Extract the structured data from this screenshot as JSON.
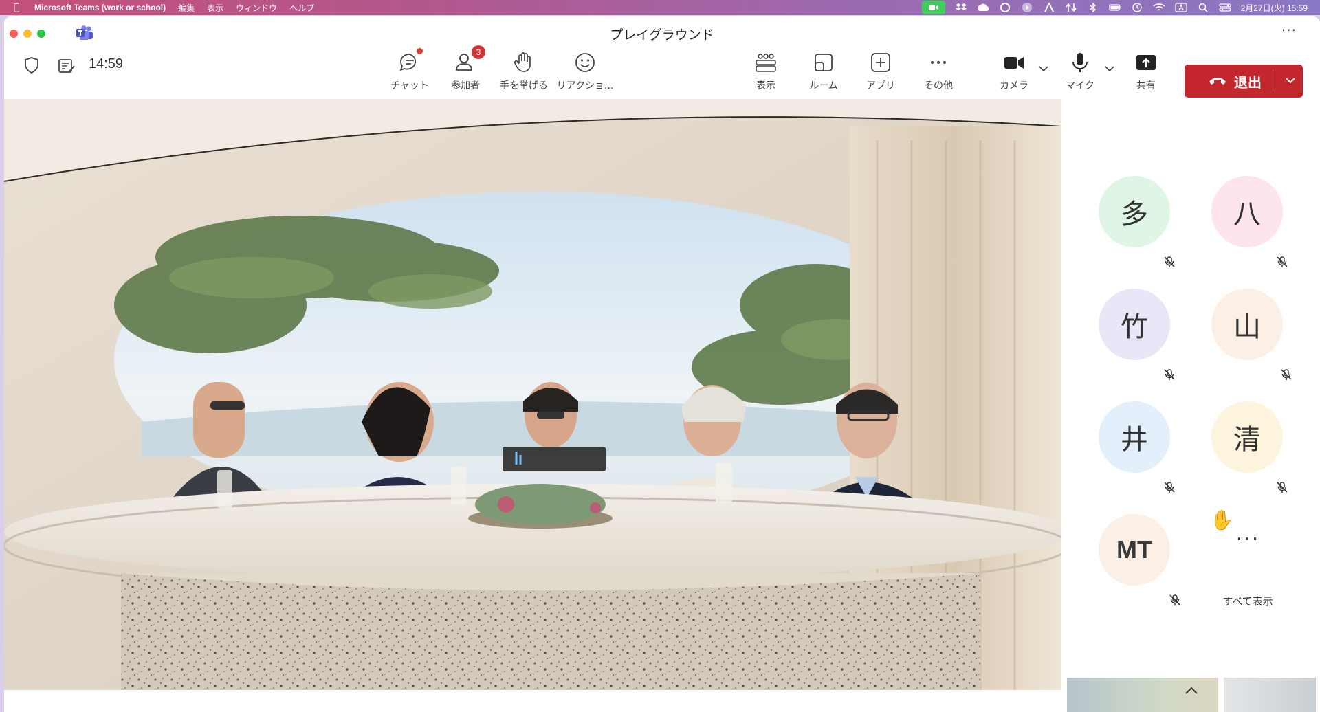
{
  "menubar": {
    "app_name": "Microsoft Teams (work or school)",
    "items": [
      "編集",
      "表示",
      "ウィンドウ",
      "ヘルプ"
    ],
    "clock": "2月27日(火) 15:59"
  },
  "window": {
    "title": "プレイグラウンド",
    "timer": "14:59"
  },
  "toolbar": {
    "chat_label": "チャット",
    "participants_label": "参加者",
    "participants_badge": "3",
    "raise_hand_label": "手を挙げる",
    "reactions_label": "リアクショ...",
    "view_label": "表示",
    "rooms_label": "ルーム",
    "apps_label": "アプリ",
    "more_label": "その他",
    "camera_label": "カメラ",
    "mic_label": "マイク",
    "share_label": "共有",
    "leave_label": "退出"
  },
  "participants": [
    {
      "initial": "多",
      "color": "#dff6e4"
    },
    {
      "initial": "八",
      "color": "#fde4ee"
    },
    {
      "initial": "竹",
      "color": "#ebe6f7"
    },
    {
      "initial": "山",
      "color": "#fbefe6"
    },
    {
      "initial": "井",
      "color": "#e3f0fb"
    },
    {
      "initial": "清",
      "color": "#fdf4de"
    },
    {
      "initial": "MT",
      "color": "#fbefe6"
    }
  ],
  "panel": {
    "more_symbol": "...",
    "show_all_label": "すべて表示",
    "hand_emoji": "✋"
  }
}
